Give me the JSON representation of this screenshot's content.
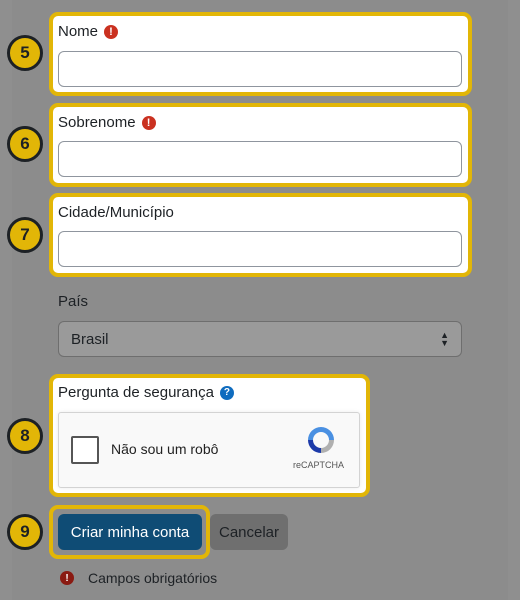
{
  "fields": {
    "nome": {
      "label": "Nome",
      "value": "",
      "step": "5"
    },
    "sobrenome": {
      "label": "Sobrenome",
      "value": "",
      "step": "6"
    },
    "cidade": {
      "label": "Cidade/Município",
      "value": "",
      "step": "7"
    }
  },
  "pais": {
    "label": "País",
    "selected": "Brasil"
  },
  "security": {
    "label": "Pergunta de segurança",
    "step": "8",
    "captcha_text": "Não sou um robô",
    "captcha_brand": "reCAPTCHA"
  },
  "actions": {
    "submit_label": "Criar minha conta",
    "cancel_label": "Cancelar",
    "step": "9"
  },
  "required_note": "Campos obrigatórios",
  "icons": {
    "required": "!",
    "help": "?"
  },
  "colors": {
    "highlight": "#e2b607",
    "primary": "#0f4c75",
    "required": "#ca3120",
    "help": "#0f6cbf"
  }
}
